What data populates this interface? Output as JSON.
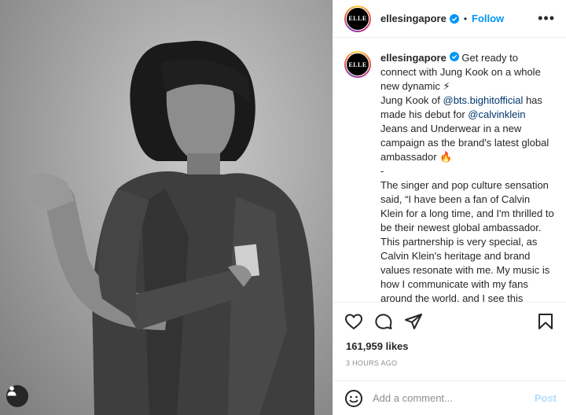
{
  "account": {
    "username": "ellesingapore",
    "avatar_text": "ELLE",
    "follow_label": "Follow",
    "separator": "•",
    "more_label": "•••"
  },
  "caption": {
    "username": "ellesingapore",
    "line1": " Get ready to connect with Jung Kook on a whole new dynamic ⚡\nJung Kook of ",
    "mention1": "@bts.bighitofficial",
    "line2": " has made his debut for ",
    "mention2": "@calvinklein",
    "line3": " Jeans and Underwear in a new campaign as the brand's latest global ambassador 🔥\n-\nThe singer and pop culture sensation said, “I have been a fan of Calvin Klein for a long time, and I'm thrilled to be their newest global ambassador. This partnership is very special, as Calvin Klein's heritage and brand values resonate with me. My music is how I communicate with my fans around the world, and I see this partnership as an opportunity to connect with them in a new way. I'm incredibly excited for"
  },
  "stats": {
    "likes": "161,959 likes",
    "time": "3 HOURS AGO"
  },
  "comment": {
    "placeholder": "Add a comment...",
    "post_label": "Post"
  },
  "icons": {
    "tag": "person-tag-icon",
    "verified": "verified-badge-icon",
    "like": "heart-icon",
    "comment": "comment-icon",
    "share": "paper-plane-icon",
    "save": "bookmark-icon",
    "emoji": "smiley-icon"
  },
  "colors": {
    "accent": "#0095f6",
    "mention": "#00376b",
    "muted": "#8e8e8e",
    "post_disabled": "#b3dbff"
  }
}
